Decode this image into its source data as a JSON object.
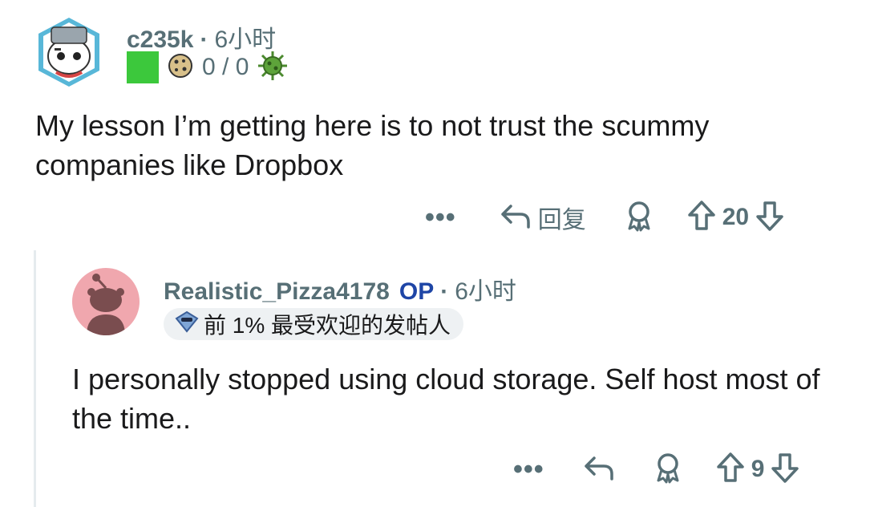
{
  "comments": [
    {
      "username": "c235k",
      "separator": "·",
      "time": "6小时",
      "flair_score": "0 / 0",
      "body": "My lesson I’m getting here is to not trust the scummy companies like Dropbox",
      "reply_label": "回复",
      "more_label": "•••",
      "votes": "20"
    },
    {
      "username": "Realistic_Pizza4178",
      "op_label": "OP",
      "separator": "·",
      "time": "6小时",
      "badge": "前 1% 最受欢迎的发帖人",
      "body": "I personally stopped using cloud storage. Self host most of the time..",
      "more_label": "•••",
      "votes": "9"
    }
  ],
  "colors": {
    "meta_gray": "#576f76",
    "op_blue": "#1e45a6",
    "flair_green": "#3cc83c",
    "badge_bg": "#eef1f3",
    "thread_line": "#e5ebee",
    "avatar2_bg": "#f0a7ae"
  },
  "icons": [
    "reply-icon",
    "award-icon",
    "upvote-icon",
    "downvote-icon",
    "virus-icon",
    "cookie-icon",
    "snoo-badge-icon"
  ]
}
